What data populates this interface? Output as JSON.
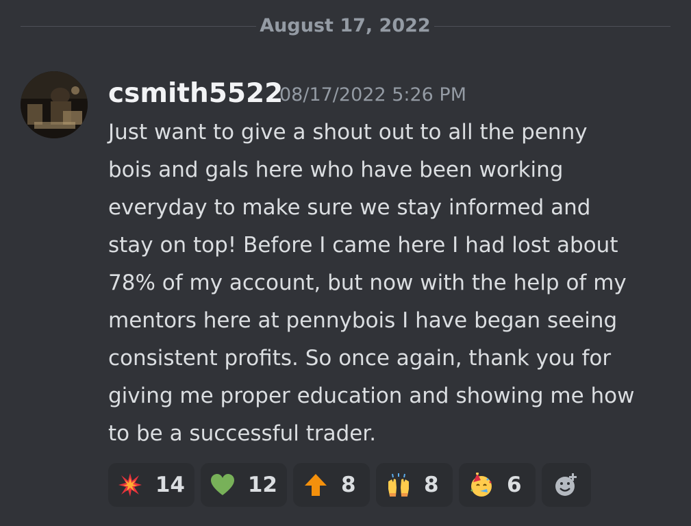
{
  "date_divider": "August 17, 2022",
  "message": {
    "author": "csmith5522",
    "timestamp": "08/17/2022 5:26 PM",
    "lines": [
      "Just want to give a shout out to all the penny",
      "bois and gals here who have been working",
      "everyday to make sure we stay informed and",
      "stay on top! Before I came here I had lost about",
      "78% of my account, but now with the help of my",
      "mentors here at pennybois I have began seeing",
      "consistent profits. So once again, thank you for",
      "giving me proper education and showing me how",
      "to be a successful trader."
    ]
  },
  "reactions": [
    {
      "emoji": "collision-icon",
      "count": "14"
    },
    {
      "emoji": "green-heart-icon",
      "count": "12"
    },
    {
      "emoji": "up-arrow-icon",
      "count": "8"
    },
    {
      "emoji": "raised-hands-icon",
      "count": "8"
    },
    {
      "emoji": "partying-face-icon",
      "count": "6"
    }
  ],
  "add_reaction_icon": "add-reaction-icon",
  "colors": {
    "background": "#313338",
    "reaction_bg": "#2b2d31",
    "muted_text": "#949ba4",
    "username": "#f2f3f5",
    "body_text": "#dbdee1"
  }
}
